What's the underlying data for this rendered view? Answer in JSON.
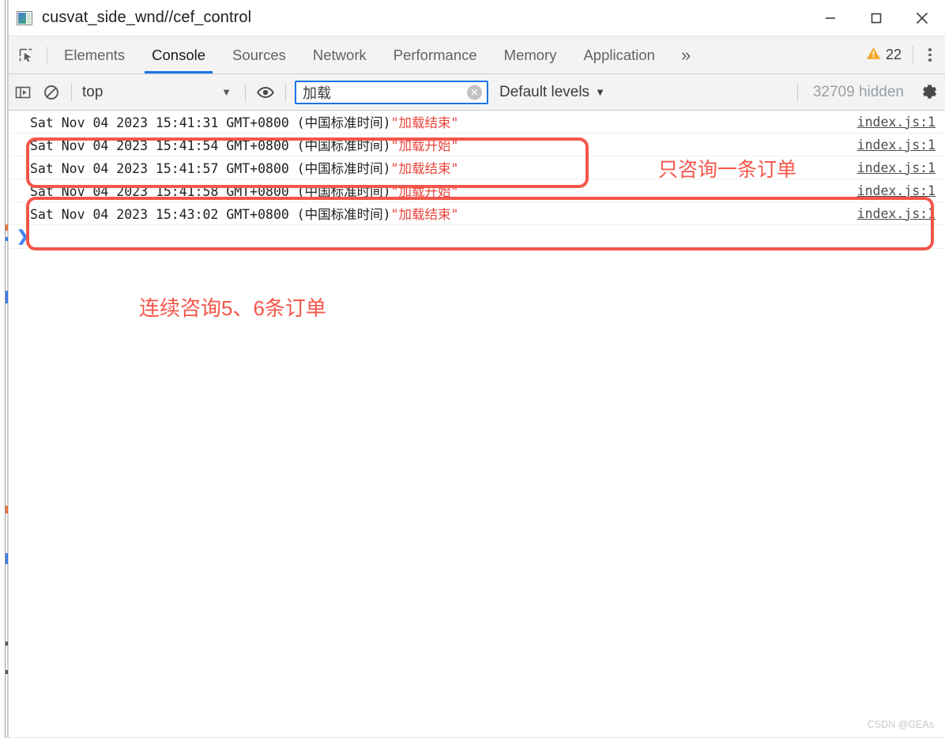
{
  "window": {
    "title": "cusvat_side_wnd//cef_control",
    "icon": "app-window-icon",
    "controls": {
      "minimize": "minimize-icon",
      "maximize": "maximize-icon",
      "close": "close-icon"
    }
  },
  "devtools": {
    "inspect_icon": "inspect-element-icon",
    "device_icon": "device-toolbar-icon",
    "tabs": [
      {
        "label": "Elements",
        "active": false
      },
      {
        "label": "Console",
        "active": true
      },
      {
        "label": "Sources",
        "active": false
      },
      {
        "label": "Network",
        "active": false
      },
      {
        "label": "Performance",
        "active": false
      },
      {
        "label": "Memory",
        "active": false
      },
      {
        "label": "Application",
        "active": false
      }
    ],
    "more_tabs_label": "»",
    "warning_count": "22",
    "warning_color": "#f5a623",
    "kebab_label": "more-options"
  },
  "console_toolbar": {
    "sidebar_toggle_icon": "console-sidebar-toggle-icon",
    "clear_icon": "clear-console-icon",
    "context": {
      "value": "top",
      "caret": "▼"
    },
    "eye_icon": "live-expression-icon",
    "filter": {
      "value": "加载",
      "placeholder": "Filter",
      "clear_label": "✕"
    },
    "levels": {
      "label": "Default levels",
      "caret": "▼"
    },
    "hidden_messages": "32709 hidden",
    "settings_icon": "gear-icon"
  },
  "console": {
    "prompt_caret": "❯",
    "logs": [
      {
        "message": "Sat Nov 04 2023 15:41:31 GMT+0800 (中国标准时间) ",
        "quoted": "\"加载结束\"",
        "source": "index.js:1"
      },
      {
        "message": "Sat Nov 04 2023 15:41:54 GMT+0800 (中国标准时间) ",
        "quoted": "\"加载开始\"",
        "source": "index.js:1"
      },
      {
        "message": "Sat Nov 04 2023 15:41:57 GMT+0800 (中国标准时间) ",
        "quoted": "\"加载结束\"",
        "source": "index.js:1"
      },
      {
        "message": "Sat Nov 04 2023 15:41:58 GMT+0800 (中国标准时间) ",
        "quoted": "\"加载开始\"",
        "source": "index.js:1"
      },
      {
        "message": "Sat Nov 04 2023 15:43:02 GMT+0800 (中国标准时间) ",
        "quoted": "\"加载结束\"",
        "source": "index.js:1"
      }
    ]
  },
  "annotations": {
    "color": "#f4564a",
    "note_1": "只咨询一条订单",
    "note_2": "连续咨询5、6条订单"
  },
  "watermark": "CSDN @GEAs"
}
